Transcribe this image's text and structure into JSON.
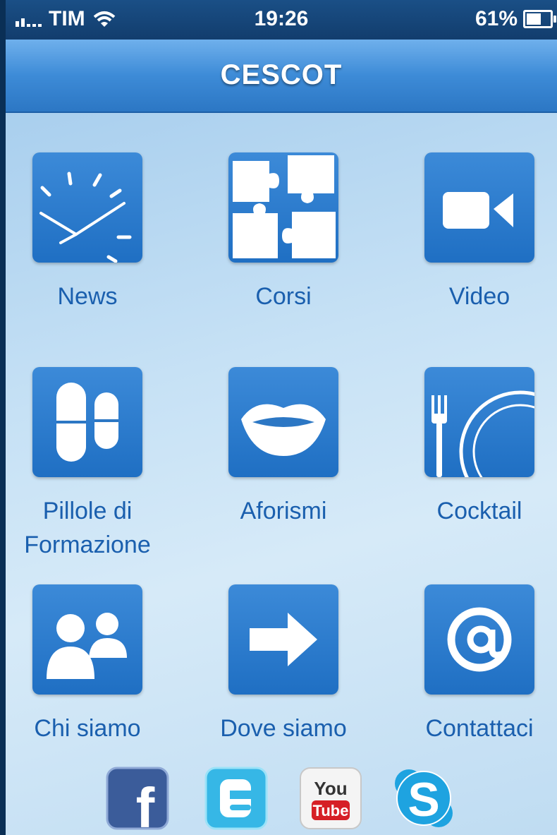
{
  "status_bar": {
    "carrier": "TIM",
    "time": "19:26",
    "battery": "61%",
    "battery_level": 0.61
  },
  "navbar": {
    "title": "CESCOT"
  },
  "menu": [
    {
      "label": "News",
      "icon": "clock-icon"
    },
    {
      "label": "Corsi",
      "icon": "puzzle-icon"
    },
    {
      "label": "Video",
      "icon": "video-camera-icon"
    },
    {
      "label": "Pillole di Formazione",
      "icon": "pills-icon"
    },
    {
      "label": "Aforismi",
      "icon": "lips-icon"
    },
    {
      "label": "Cocktail",
      "icon": "fork-plate-icon"
    },
    {
      "label": "Chi siamo",
      "icon": "people-icon"
    },
    {
      "label": "Dove siamo",
      "icon": "arrow-right-icon"
    },
    {
      "label": "Contattaci",
      "icon": "at-sign-icon"
    }
  ],
  "social": [
    {
      "name": "facebook-icon",
      "text": "f"
    },
    {
      "name": "twitter-icon",
      "text": "t"
    },
    {
      "name": "youtube-icon",
      "text_top": "You",
      "text_bottom": "Tube"
    },
    {
      "name": "skype-icon",
      "text": "S"
    }
  ],
  "colors": {
    "accent": "#2c77c4",
    "label": "#1a5fae",
    "status_bar": "#123d6d"
  }
}
